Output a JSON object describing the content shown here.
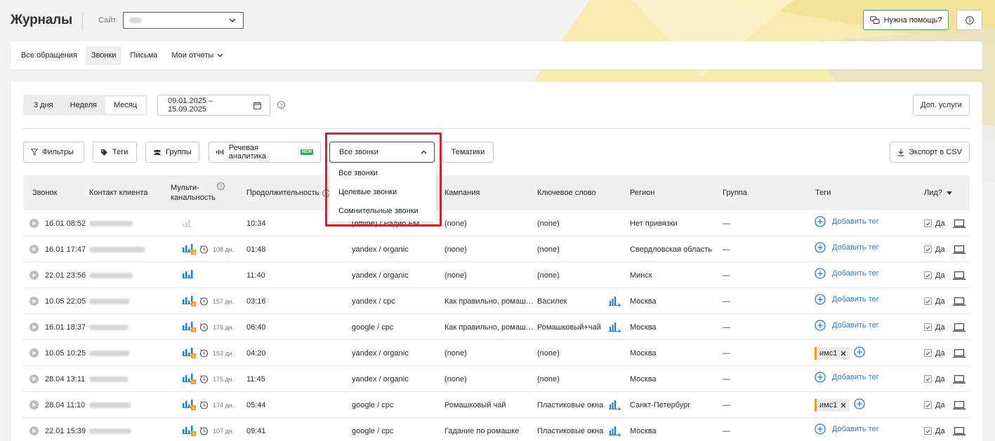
{
  "header": {
    "title": "Журналы",
    "site_label": "Сайт",
    "help_button": "Нужна помощь?"
  },
  "tabs": [
    {
      "label": "Все обращения",
      "active": false
    },
    {
      "label": "Звонки",
      "active": true
    },
    {
      "label": "Письма",
      "active": false
    },
    {
      "label": "Мои отчеты",
      "active": false
    }
  ],
  "period": {
    "options": [
      {
        "label": "3 дня",
        "active": false
      },
      {
        "label": "Неделя",
        "active": false
      },
      {
        "label": "Месяц",
        "active": true
      }
    ],
    "date_range": "09.01.2025 – 15.09.2025",
    "extra_services": "Доп. услуги"
  },
  "filters": {
    "filters": "Фильтры",
    "tags": "Теги",
    "groups": "Группы",
    "speech": "Речевая аналитика",
    "new_badge": "NEW",
    "calls_select": "Все звонки",
    "topics": "Тематики",
    "export": "Экспорт в CSV"
  },
  "dropdown": {
    "options": [
      "Все звонки",
      "Целевые звонки",
      "Сомнительные звонки"
    ]
  },
  "table": {
    "headers": {
      "call": "Звонок",
      "contact": "Контакт клиента",
      "multi_1": "Мульти-",
      "multi_2": "канальность",
      "duration": "Продолжительность",
      "source": "",
      "campaign": "Кампания",
      "keyword": "Ключевое слово",
      "region": "Регион",
      "group": "Группа",
      "tags": "Теги",
      "lead": "Лид?"
    },
    "rows": [
      {
        "date": "16.01 08:52",
        "multi": "empty",
        "days": "",
        "duration": "10:34",
        "source": "(offline) / Радио FM",
        "campaign": "(none)",
        "keyword": "(none)",
        "kwchart": false,
        "region": "Нет привязки",
        "group": "—",
        "tag": "Добавить тег",
        "chip": "",
        "lead": "Да"
      },
      {
        "date": "16.01 17:47",
        "multi": "badge",
        "days": "108 дн.",
        "duration": "01:48",
        "source": "yandex / organic",
        "campaign": "(none)",
        "keyword": "(none)",
        "kwchart": false,
        "region": "Свердловская область",
        "group": "—",
        "tag": "Добавить тег",
        "chip": "",
        "lead": "Да"
      },
      {
        "date": "22.01 23:56",
        "multi": "plain",
        "days": "",
        "duration": "11:40",
        "source": "yandex / organic",
        "campaign": "(none)",
        "keyword": "(none)",
        "kwchart": false,
        "region": "Минск",
        "group": "—",
        "tag": "Добавить тег",
        "chip": "",
        "lead": "Да"
      },
      {
        "date": "10.05 22:05",
        "multi": "badge",
        "days": "157 дн.",
        "duration": "03:16",
        "source": "yandex / cpc",
        "campaign": "Как правильно, ромаш…",
        "keyword": "Василек",
        "kwchart": true,
        "region": "Москва",
        "group": "—",
        "tag": "Добавить тег",
        "chip": "",
        "lead": "Да"
      },
      {
        "date": "16.01 18:37",
        "multi": "badge",
        "days": "176 дн.",
        "duration": "06:40",
        "source": "google / cpc",
        "campaign": "Как правильно, ромаш…",
        "keyword": "Ромашковый+чай",
        "kwchart": true,
        "region": "Москва",
        "group": "—",
        "tag": "Добавить тег",
        "chip": "",
        "lead": "Да"
      },
      {
        "date": "10.05 10:25",
        "multi": "badge",
        "days": "153 дн.",
        "duration": "04:20",
        "source": "yandex / organic",
        "campaign": "(none)",
        "keyword": "(none)",
        "kwchart": false,
        "region": "Москва",
        "group": "—",
        "tag": "",
        "chip": "имс1",
        "lead": "Да"
      },
      {
        "date": "28.04 13:11",
        "multi": "badge",
        "days": "175 дн.",
        "duration": "11:45",
        "source": "yandex / organic",
        "campaign": "(none)",
        "keyword": "(none)",
        "kwchart": false,
        "region": "Москва",
        "group": "—",
        "tag": "Добавить тег",
        "chip": "",
        "lead": "Да"
      },
      {
        "date": "28.04 11:10",
        "multi": "badge",
        "days": "174 дн.",
        "duration": "05:44",
        "source": "google / cpc",
        "campaign": "Ромашковый чай",
        "keyword": "Пластиковые окна",
        "kwchart": true,
        "region": "Санкт-Петербург",
        "group": "—",
        "tag": "",
        "chip": "имс1",
        "lead": "Да"
      },
      {
        "date": "22.01 15:39",
        "multi": "badge",
        "days": "107 дн.",
        "duration": "09:41",
        "source": "google / cpc",
        "campaign": "Гадание по ромашке",
        "keyword": "Пластиковые окна",
        "kwchart": true,
        "region": "Москва",
        "group": "—",
        "tag": "Добавить тег",
        "chip": "",
        "lead": "Да"
      }
    ]
  },
  "colors": {
    "accent_blue": "#1e7fd6",
    "highlight_red": "#d6202a",
    "tag_orange": "#f19a18",
    "help_border": "#4a9a6e"
  }
}
